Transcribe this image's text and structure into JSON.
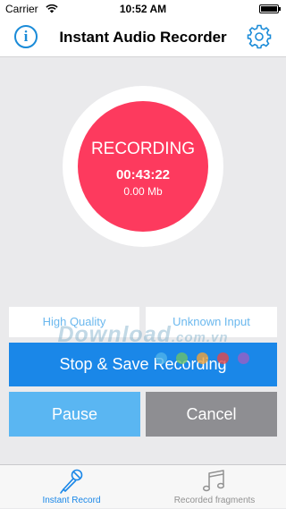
{
  "status_bar": {
    "carrier": "Carrier",
    "time": "10:52 AM"
  },
  "nav": {
    "title": "Instant Audio Recorder",
    "info_glyph": "i",
    "left_icon": "info-icon",
    "right_icon": "gear-icon"
  },
  "recorder": {
    "state": "RECORDING",
    "elapsed": "00:43:22",
    "size": "0.00 Mb",
    "color": "#fd3a5e"
  },
  "options": {
    "quality": "High Quality",
    "input": "Unknown Input"
  },
  "actions": {
    "stop_save": "Stop & Save Recording",
    "pause": "Pause",
    "cancel": "Cancel"
  },
  "watermark": {
    "main": "Download",
    "suffix": ".com.vn"
  },
  "tabs": [
    {
      "label": "Instant Record",
      "icon": "microphone-icon",
      "selected": true
    },
    {
      "label": "Recorded fragments",
      "icon": "music-notes-icon",
      "selected": false
    }
  ],
  "colors": {
    "accent": "#1a87e8",
    "light_accent": "#5ab6f2",
    "cancel": "#8e8e92"
  }
}
